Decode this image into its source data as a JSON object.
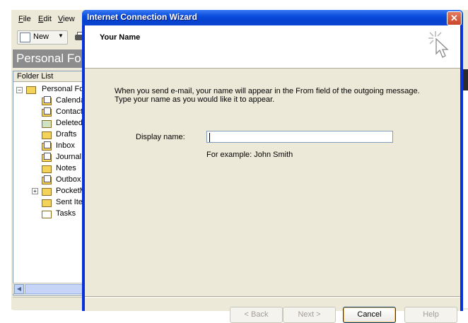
{
  "background_app": {
    "menus": [
      {
        "label": "File",
        "underline": "F"
      },
      {
        "label": "Edit",
        "underline": "E"
      },
      {
        "label": "View",
        "underline": "V"
      }
    ],
    "toolbar": {
      "new_label": "New"
    },
    "pane_title": "Personal Fo",
    "folder_list_header": "Folder List",
    "tree": {
      "root": "Personal Fo",
      "items": [
        "Calenda",
        "Contact",
        "Deleted",
        "Drafts",
        "Inbox",
        "Journal",
        "Notes",
        "Outbox",
        "PocketM",
        "Sent Ite",
        "Tasks"
      ]
    }
  },
  "wizard": {
    "title": "Internet Connection Wizard",
    "header_title": "Your Name",
    "intro_line1": "When you send e-mail, your name will appear in the From field of the outgoing message.",
    "intro_line2": "Type your name as you would like it to appear.",
    "display_name_label": "Display name:",
    "display_name_value": "",
    "example": "For example: John Smith",
    "buttons": {
      "back": "< Back",
      "next": "Next >",
      "cancel": "Cancel",
      "help": "Help"
    },
    "close_glyph": "✕"
  }
}
